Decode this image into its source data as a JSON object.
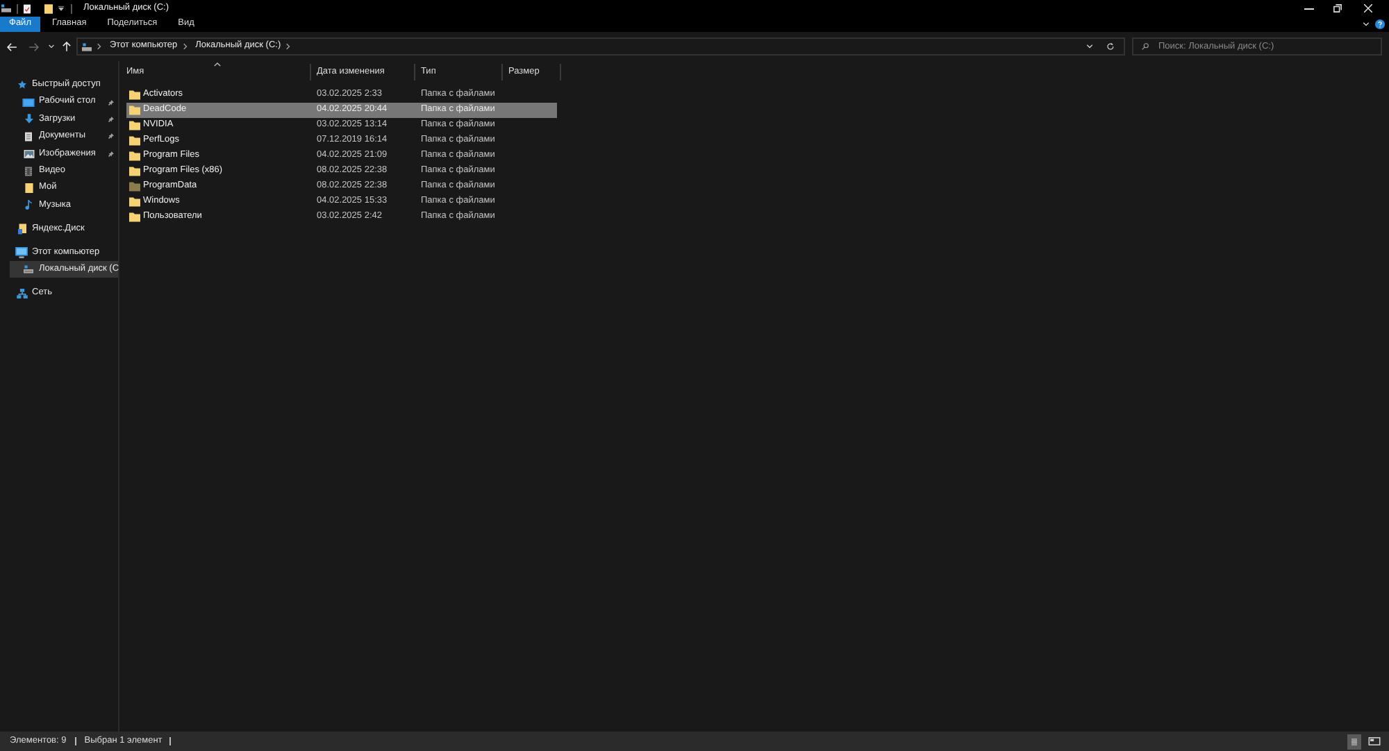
{
  "window": {
    "title": "Локальный диск (C:)"
  },
  "ribbon": {
    "tabs": [
      {
        "label": "Файл",
        "selected": true
      },
      {
        "label": "Главная",
        "selected": false
      },
      {
        "label": "Поделиться",
        "selected": false
      },
      {
        "label": "Вид",
        "selected": false
      }
    ]
  },
  "navigation": {
    "back": {
      "disabled": false
    },
    "forward": {
      "disabled": true
    }
  },
  "address_bar": {
    "path": [
      "Этот компьютер",
      "Локальный диск (C:)"
    ]
  },
  "search": {
    "placeholder": "Поиск: Локальный диск (C:)"
  },
  "sidebar": {
    "items": [
      {
        "label": "Быстрый доступ",
        "kind": "star",
        "selected": false,
        "children": [
          {
            "label": "Рабочий стол",
            "kind": "desktop",
            "pinned": true,
            "selected": false
          },
          {
            "label": "Загрузки",
            "kind": "download",
            "pinned": true,
            "selected": false
          },
          {
            "label": "Документы",
            "kind": "documents",
            "pinned": true,
            "selected": false
          },
          {
            "label": "Изображения",
            "kind": "pictures",
            "pinned": true,
            "selected": false
          },
          {
            "label": "Видео",
            "kind": "videos",
            "pinned": false,
            "selected": false
          },
          {
            "label": "Мой",
            "kind": "folder",
            "pinned": false,
            "selected": false
          },
          {
            "label": "Музыка",
            "kind": "music",
            "pinned": false,
            "selected": false
          }
        ]
      },
      {
        "label": "Яндекс.Диск",
        "kind": "synced",
        "selected": false
      },
      {
        "label": "Этот компьютер",
        "kind": "computer",
        "selected": false,
        "children": [
          {
            "label": "Локальный диск (C",
            "kind": "drive",
            "selected": true
          }
        ]
      },
      {
        "label": "Сеть",
        "kind": "network",
        "selected": false
      }
    ]
  },
  "file_list": {
    "columns": [
      {
        "label": "Имя",
        "sorted": true
      },
      {
        "label": "Дата изменения",
        "sorted": false
      },
      {
        "label": "Тип",
        "sorted": false
      },
      {
        "label": "Размер",
        "sorted": false
      }
    ],
    "rows": [
      {
        "name": "Activators",
        "modified": "03.02.2025 2:33",
        "type": "Папка с файлами",
        "selected": false,
        "hidden": false
      },
      {
        "name": "DeadCode",
        "modified": "04.02.2025 20:44",
        "type": "Папка с файлами",
        "selected": true,
        "hidden": false
      },
      {
        "name": "NVIDIA",
        "modified": "03.02.2025 13:14",
        "type": "Папка с файлами",
        "selected": false,
        "hidden": false
      },
      {
        "name": "PerfLogs",
        "modified": "07.12.2019 16:14",
        "type": "Папка с файлами",
        "selected": false,
        "hidden": false
      },
      {
        "name": "Program Files",
        "modified": "04.02.2025 21:09",
        "type": "Папка с файлами",
        "selected": false,
        "hidden": false
      },
      {
        "name": "Program Files (x86)",
        "modified": "08.02.2025 22:38",
        "type": "Папка с файлами",
        "selected": false,
        "hidden": false
      },
      {
        "name": "ProgramData",
        "modified": "08.02.2025 22:38",
        "type": "Папка с файлами",
        "selected": false,
        "hidden": true
      },
      {
        "name": "Windows",
        "modified": "04.02.2025 15:33",
        "type": "Папка с файлами",
        "selected": false,
        "hidden": false
      },
      {
        "name": "Пользователи",
        "modified": "03.02.2025 2:42",
        "type": "Папка с файлами",
        "selected": false,
        "hidden": false
      }
    ]
  },
  "status_bar": {
    "item_count": "Элементов: 9",
    "selection": "Выбран 1 элемент"
  },
  "view_buttons": [
    {
      "kind": "details",
      "selected": true
    },
    {
      "kind": "tiles",
      "selected": false
    }
  ]
}
